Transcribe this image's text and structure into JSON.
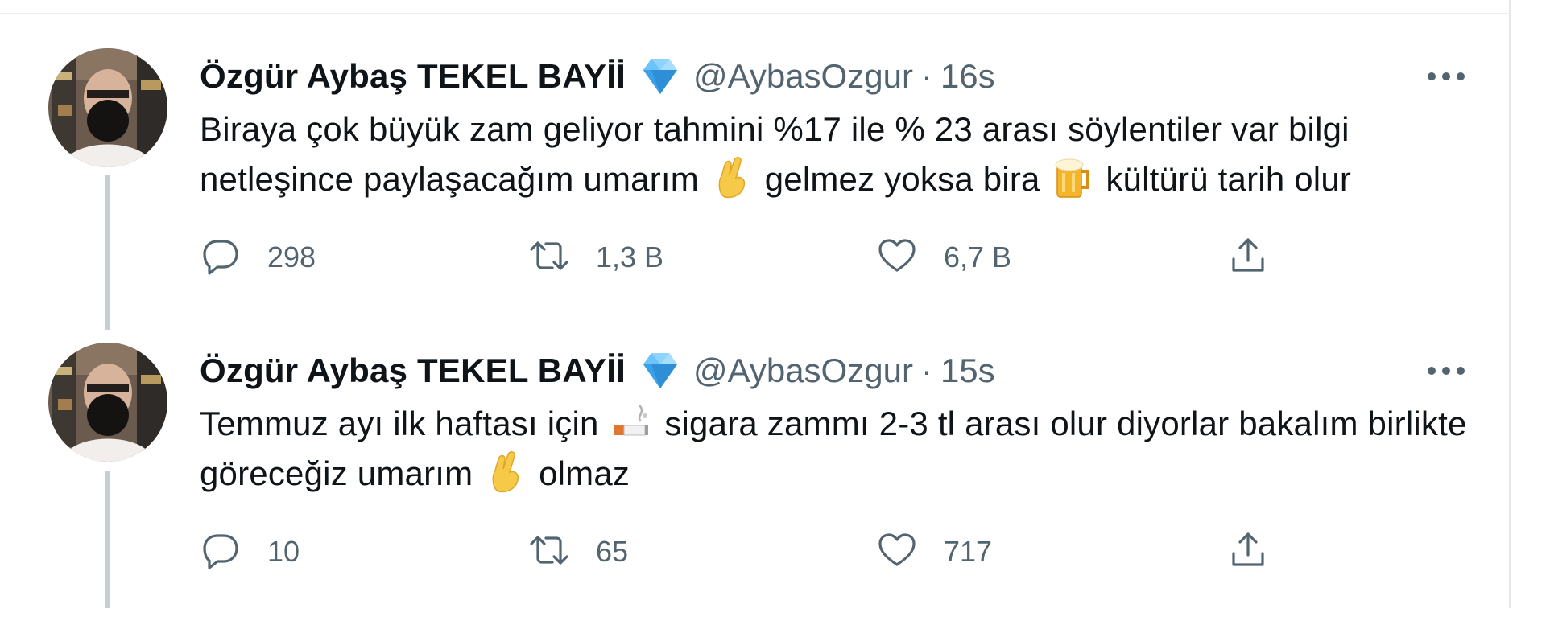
{
  "tweets": [
    {
      "display_name": "Özgür Aybaş TEKEL BAYİİ",
      "handle": "@AybasOzgur",
      "separator": "·",
      "timestamp": "16s",
      "text_parts": [
        "Biraya çok büyük zam geliyor tahmini %17 ile % 23 arası söylentiler var bilgi netleşince paylaşacağım umarım",
        "gelmez yoksa bira",
        "kültürü tarih olur"
      ],
      "emojis": [
        "crossed-fingers-emoji",
        "beer-mug-emoji"
      ],
      "reply_count": "298",
      "retweet_count": "1,3 B",
      "like_count": "6,7 B"
    },
    {
      "display_name": "Özgür Aybaş TEKEL BAYİİ",
      "handle": "@AybasOzgur",
      "separator": "·",
      "timestamp": "15s",
      "text_parts": [
        "Temmuz ayı ilk haftası için",
        "sigara zammı  2-3 tl arası olur diyorlar bakalım birlikte göreceğiz umarım",
        "olmaz"
      ],
      "emojis": [
        "cigarette-emoji",
        "crossed-fingers-emoji"
      ],
      "reply_count": "10",
      "retweet_count": "65",
      "like_count": "717"
    }
  ],
  "icons": {
    "verified": "diamond-icon",
    "more": "more-options-icon",
    "reply": "reply-icon",
    "retweet": "retweet-icon",
    "like": "like-icon",
    "share": "share-icon"
  },
  "colors": {
    "text_primary": "#0f1419",
    "text_secondary": "#536471",
    "thread_line": "#c4cfd6",
    "diamond": "#4fb3f6"
  }
}
